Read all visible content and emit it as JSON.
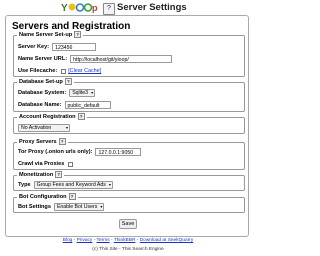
{
  "header": {
    "help_badge": "?",
    "title": "Server Settings"
  },
  "panel": {
    "title": "Servers and Registration"
  },
  "name_server": {
    "legend": "Name Server Set-up",
    "server_key_label": "Server Key:",
    "server_key_value": "123456",
    "server_url_label": "Name Server URL:",
    "server_url_value": "http://localhost/git/yioop/",
    "filecache_label": "Use Filecache:",
    "clear_cache_label": "[Clear Cache]"
  },
  "database": {
    "legend": "Database Set-up",
    "system_label": "Database System:",
    "system_value": "Sqlite3",
    "name_label": "Database Name:",
    "name_value": "public_default"
  },
  "account": {
    "legend": "Account Registration",
    "value": "No Activation"
  },
  "proxy": {
    "legend": "Proxy Servers",
    "tor_label": "Tor Proxy (.onion urls only):",
    "tor_value": "127.0.0.1:9050",
    "crawl_label": "Crawl via Proxies"
  },
  "monetization": {
    "legend": "Monetization",
    "type_label": "Type",
    "type_value": "Group Fees and Keyword Ads"
  },
  "bot": {
    "legend": "Bot Configuration",
    "settings_label": "Bot Settings",
    "settings_value": "Enable Bot Users"
  },
  "save_label": "Save",
  "footer": {
    "links": [
      "Blog",
      "Privacy",
      "Terms",
      "ThinkBBR",
      "Download at SeekQuarry"
    ],
    "separator": "-",
    "line2": "(c) This Site - This Search Engine"
  },
  "colors": {
    "link": "#1a33cc",
    "border": "#999999"
  }
}
